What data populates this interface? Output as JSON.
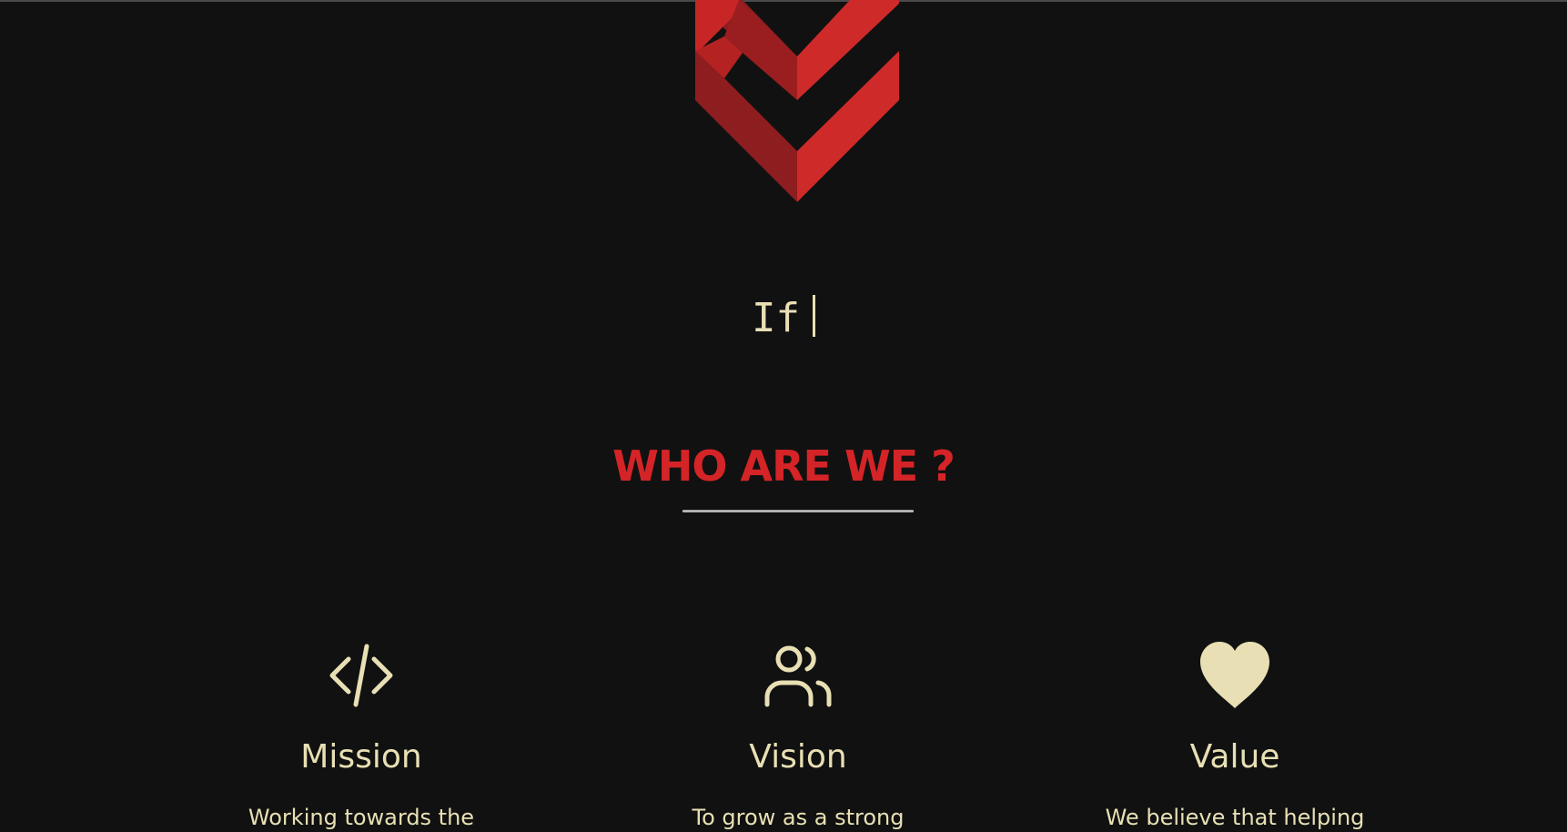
{
  "colors": {
    "background": "#111111",
    "accent": "#d42427",
    "text": "#e8e0b4"
  },
  "hero": {
    "typing_text": "If"
  },
  "about": {
    "title": "WHO ARE WE ?",
    "cards": [
      {
        "icon": "code-icon",
        "title": "Mission",
        "text": "Working towards the"
      },
      {
        "icon": "users-icon",
        "title": "Vision",
        "text": "To grow as a strong"
      },
      {
        "icon": "heart-icon",
        "title": "Value",
        "text": "We believe that helping"
      }
    ]
  }
}
